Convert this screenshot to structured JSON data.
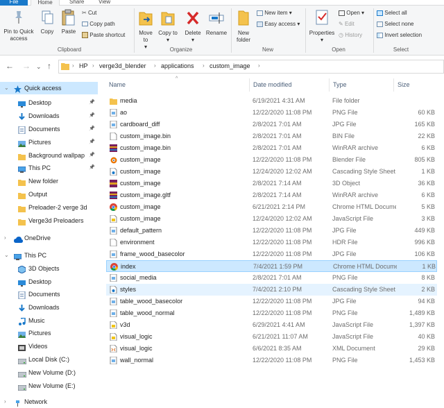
{
  "tabs": {
    "file": "File",
    "home": "Home",
    "share": "Share",
    "view": "View"
  },
  "ribbon": {
    "clipboard": {
      "pin": "Pin to Quick access",
      "copy": "Copy",
      "paste": "Paste",
      "cut": "Cut",
      "copy_path": "Copy path",
      "paste_shortcut": "Paste shortcut",
      "group": "Clipboard"
    },
    "organize": {
      "move_to": "Move to",
      "copy_to": "Copy to",
      "delete": "Delete",
      "rename": "Rename",
      "group": "Organize"
    },
    "new": {
      "new_folder": "New folder",
      "new_item": "New item",
      "easy_access": "Easy access",
      "group": "New"
    },
    "open": {
      "properties": "Properties",
      "open": "Open",
      "edit": "Edit",
      "history": "History",
      "group": "Open"
    },
    "select": {
      "select_all": "Select all",
      "select_none": "Select none",
      "invert": "Invert selection",
      "group": "Select"
    }
  },
  "address": {
    "crumbs": [
      "HP",
      "verge3d_blender",
      "applications",
      "custom_image"
    ]
  },
  "sidebar": [
    {
      "label": "Quick access",
      "icon": "star-icon",
      "pinned": false,
      "selected": true
    },
    {
      "label": "Desktop",
      "icon": "desktop-icon",
      "pinned": true
    },
    {
      "label": "Downloads",
      "icon": "download-icon",
      "pinned": true
    },
    {
      "label": "Documents",
      "icon": "documents-icon",
      "pinned": true
    },
    {
      "label": "Pictures",
      "icon": "pictures-icon",
      "pinned": true
    },
    {
      "label": "Background wallpap",
      "icon": "folder-icon",
      "pinned": true
    },
    {
      "label": "This PC",
      "icon": "pc-icon",
      "pinned": true
    },
    {
      "label": "New folder",
      "icon": "folder-icon",
      "pinned": false
    },
    {
      "label": "Output",
      "icon": "folder-icon",
      "pinned": false
    },
    {
      "label": "Preloader-2 verge 3d",
      "icon": "folder-icon",
      "pinned": false
    },
    {
      "label": "Verge3d Preloaders",
      "icon": "folder-icon",
      "pinned": false
    },
    {
      "label": "OneDrive",
      "icon": "cloud-icon",
      "pinned": false
    },
    {
      "label": "This PC",
      "icon": "pc-icon",
      "pinned": false
    },
    {
      "label": "3D Objects",
      "icon": "3d-objects-icon",
      "pinned": false
    },
    {
      "label": "Desktop",
      "icon": "desktop-icon",
      "pinned": false
    },
    {
      "label": "Documents",
      "icon": "documents-icon",
      "pinned": false
    },
    {
      "label": "Downloads",
      "icon": "download-icon",
      "pinned": false
    },
    {
      "label": "Music",
      "icon": "music-icon",
      "pinned": false
    },
    {
      "label": "Pictures",
      "icon": "pictures-icon",
      "pinned": false
    },
    {
      "label": "Videos",
      "icon": "videos-icon",
      "pinned": false
    },
    {
      "label": "Local Disk (C:)",
      "icon": "disk-icon",
      "pinned": false
    },
    {
      "label": "New Volume (D:)",
      "icon": "disk-icon",
      "pinned": false
    },
    {
      "label": "New Volume (E:)",
      "icon": "disk-icon",
      "pinned": false
    },
    {
      "label": "Network",
      "icon": "network-icon",
      "pinned": false
    }
  ],
  "columns": {
    "name": "Name",
    "date": "Date modified",
    "type": "Type",
    "size": "Size"
  },
  "files": [
    {
      "name": "media",
      "date": "6/19/2021 4:31 AM",
      "type": "File folder",
      "size": "",
      "icon": "folder-icon"
    },
    {
      "name": "ao",
      "date": "12/22/2020 11:08 PM",
      "type": "PNG File",
      "size": "60 KB",
      "icon": "image-file-icon"
    },
    {
      "name": "cardboard_diff",
      "date": "2/8/2021 7:01 AM",
      "type": "JPG File",
      "size": "165 KB",
      "icon": "image-file-icon"
    },
    {
      "name": "custom_image.bin",
      "date": "2/8/2021 7:01 AM",
      "type": "BIN File",
      "size": "22 KB",
      "icon": "blank-file-icon"
    },
    {
      "name": "custom_image.bin",
      "date": "2/8/2021 7:01 AM",
      "type": "WinRAR archive",
      "size": "6 KB",
      "icon": "winrar-icon"
    },
    {
      "name": "custom_image",
      "date": "12/22/2020 11:08 PM",
      "type": "Blender File",
      "size": "805 KB",
      "icon": "blender-icon"
    },
    {
      "name": "custom_image",
      "date": "12/24/2020 12:02 AM",
      "type": "Cascading Style Sheet",
      "size": "1 KB",
      "icon": "css-file-icon"
    },
    {
      "name": "custom_image",
      "date": "2/8/2021 7:14 AM",
      "type": "3D Object",
      "size": "36 KB",
      "icon": "3d-file-icon"
    },
    {
      "name": "custom_image.gltf",
      "date": "2/8/2021 7:14 AM",
      "type": "WinRAR archive",
      "size": "6 KB",
      "icon": "winrar-icon"
    },
    {
      "name": "custom_image",
      "date": "6/21/2021 2:14 PM",
      "type": "Chrome HTML Document",
      "size": "5 KB",
      "icon": "chrome-icon"
    },
    {
      "name": "custom_image",
      "date": "12/24/2020 12:02 AM",
      "type": "JavaScript File",
      "size": "3 KB",
      "icon": "js-file-icon"
    },
    {
      "name": "default_pattern",
      "date": "12/22/2020 11:08 PM",
      "type": "JPG File",
      "size": "449 KB",
      "icon": "image-file-icon"
    },
    {
      "name": "environment",
      "date": "12/22/2020 11:08 PM",
      "type": "HDR File",
      "size": "996 KB",
      "icon": "blank-file-icon"
    },
    {
      "name": "frame_wood_basecolor",
      "date": "12/22/2020 11:08 PM",
      "type": "JPG File",
      "size": "106 KB",
      "icon": "image-file-icon"
    },
    {
      "name": "index",
      "date": "7/4/2021 1:59 PM",
      "type": "Chrome HTML Document",
      "size": "1 KB",
      "icon": "chrome-icon",
      "state": "sel"
    },
    {
      "name": "social_media",
      "date": "2/8/2021 7:01 AM",
      "type": "PNG File",
      "size": "8 KB",
      "icon": "image-file-icon"
    },
    {
      "name": "styles",
      "date": "7/4/2021 2:10 PM",
      "type": "Cascading Style Sheet",
      "size": "2 KB",
      "icon": "css-file-icon",
      "state": "hl"
    },
    {
      "name": "table_wood_basecolor",
      "date": "12/22/2020 11:08 PM",
      "type": "JPG File",
      "size": "94 KB",
      "icon": "image-file-icon"
    },
    {
      "name": "table_wood_normal",
      "date": "12/22/2020 11:08 PM",
      "type": "PNG File",
      "size": "1,489 KB",
      "icon": "image-file-icon"
    },
    {
      "name": "v3d",
      "date": "6/29/2021 4:41 AM",
      "type": "JavaScript File",
      "size": "1,397 KB",
      "icon": "js-file-icon"
    },
    {
      "name": "visual_logic",
      "date": "6/21/2021 11:07 AM",
      "type": "JavaScript File",
      "size": "40 KB",
      "icon": "js-file-icon"
    },
    {
      "name": "visual_logic",
      "date": "6/6/2021 8:35 AM",
      "type": "XML Document",
      "size": "29 KB",
      "icon": "xml-file-icon"
    },
    {
      "name": "wall_normal",
      "date": "12/22/2020 11:08 PM",
      "type": "PNG File",
      "size": "1,453 KB",
      "icon": "image-file-icon"
    }
  ],
  "colors": {
    "accent": "#1979ca",
    "folder": "#f4c24d",
    "selection": "#cce8ff",
    "hover": "#e5f3ff"
  }
}
